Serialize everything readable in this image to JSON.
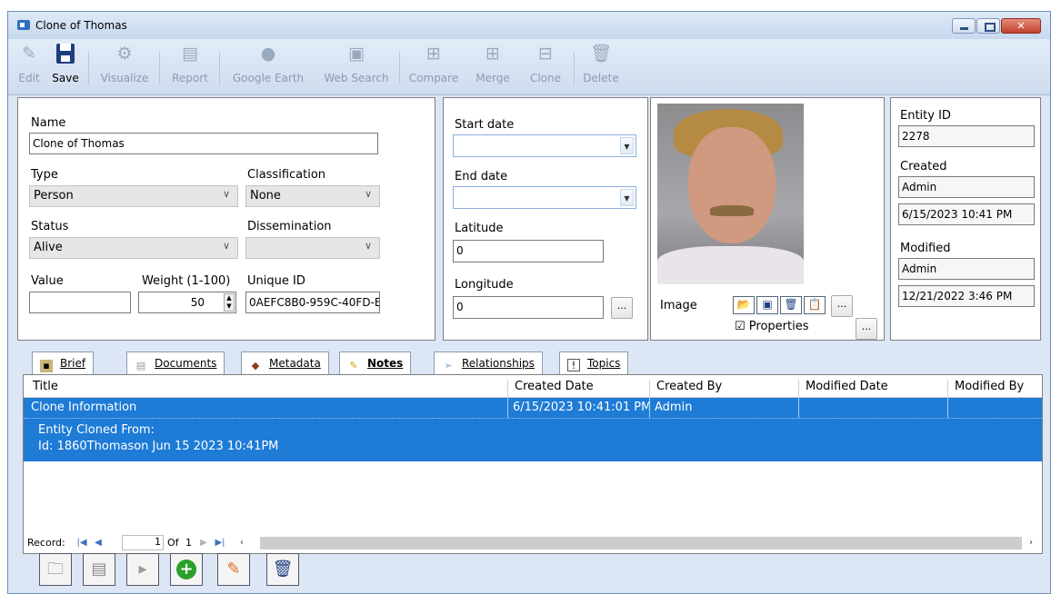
{
  "window": {
    "title": "Clone of Thomas"
  },
  "toolbar": {
    "edit": "Edit",
    "save": "Save",
    "visualize": "Visualize",
    "report": "Report",
    "google_earth": "Google Earth",
    "web_search": "Web Search",
    "compare": "Compare",
    "merge": "Merge",
    "clone": "Clone",
    "delete": "Delete"
  },
  "form": {
    "name_label": "Name",
    "name_value": "Clone of Thomas",
    "type_label": "Type",
    "type_value": "Person",
    "classification_label": "Classification",
    "classification_value": "None",
    "status_label": "Status",
    "status_value": "Alive",
    "dissemination_label": "Dissemination",
    "dissemination_value": "",
    "value_label": "Value",
    "value_value": "",
    "weight_label": "Weight (1-100)",
    "weight_value": "50",
    "unique_id_label": "Unique ID",
    "unique_id_value": "0AEFC8B0-959C-40FD-E"
  },
  "dates": {
    "start_label": "Start date",
    "start_value": "",
    "end_label": "End date",
    "end_value": "",
    "latitude_label": "Latitude",
    "latitude_value": "0",
    "longitude_label": "Longitude",
    "longitude_value": "0",
    "ellipsis": "..."
  },
  "image": {
    "label": "Image",
    "properties_label": "Properties",
    "properties_checked": true
  },
  "meta": {
    "entity_id_label": "Entity ID",
    "entity_id_value": "2278",
    "created_label": "Created",
    "created_by": "Admin",
    "created_date": "6/15/2023 10:41 PM",
    "modified_label": "Modified",
    "modified_by": "Admin",
    "modified_date": "12/21/2022 3:46 PM"
  },
  "tabs": [
    {
      "label": "Brief"
    },
    {
      "label": "Documents"
    },
    {
      "label": "Metadata"
    },
    {
      "label": "Notes"
    },
    {
      "label": "Relationships"
    },
    {
      "label": "Topics"
    }
  ],
  "notes_grid": {
    "columns": [
      "Title",
      "Created Date",
      "Created By",
      "Modified Date",
      "Modified By"
    ],
    "rows": [
      {
        "title": "Clone Information",
        "created_date": "6/15/2023 10:41:01 PM",
        "created_by": "Admin",
        "modified_date": "",
        "modified_by": "",
        "detail_line1": "Entity Cloned From:",
        "detail_line2": "Id: 1860Thomason Jun 15 2023 10:41PM"
      }
    ]
  },
  "navigator": {
    "record_label": "Record:",
    "page": "1",
    "of_label": "Of",
    "total": "1"
  },
  "colors": {
    "selection": "#1e7bd6",
    "window_chrome": "#dce6f4",
    "save_icon": "#1e3f7d"
  }
}
